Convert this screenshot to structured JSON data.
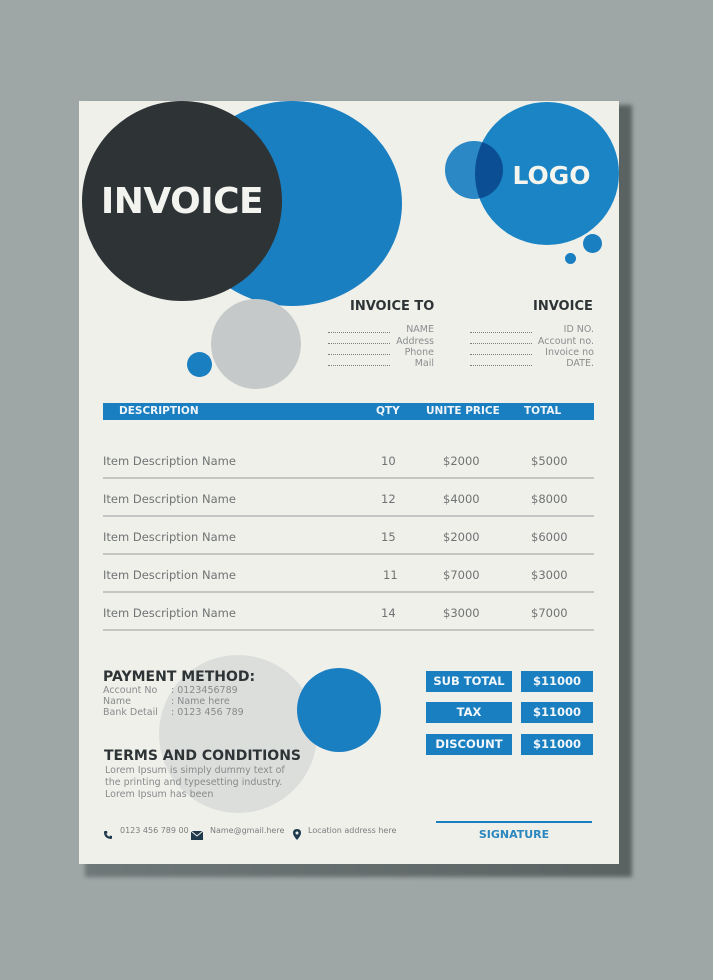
{
  "header": {
    "title": "INVOICE",
    "logo_text": "LOGO"
  },
  "invoice_to": {
    "heading": "INVOICE TO",
    "fields": [
      "NAME",
      "Address",
      "Phone",
      "Mail"
    ]
  },
  "invoice_info": {
    "heading": "INVOICE",
    "fields": [
      "ID NO.",
      "Account no.",
      "Invoice no",
      "DATE."
    ]
  },
  "table": {
    "columns": [
      "DESCRIPTION",
      "QTY",
      "UNITE PRICE",
      "TOTAL"
    ],
    "rows": [
      {
        "description": "Item Description Name",
        "qty": "10",
        "price": "$2000",
        "total": "$5000"
      },
      {
        "description": "Item Description Name",
        "qty": "12",
        "price": "$4000",
        "total": "$8000"
      },
      {
        "description": "Item Description Name",
        "qty": "15",
        "price": "$2000",
        "total": "$6000"
      },
      {
        "description": "Item Description Name",
        "qty": "11",
        "price": "$7000",
        "total": "$3000"
      },
      {
        "description": "Item Description Name",
        "qty": "14",
        "price": "$3000",
        "total": "$7000"
      }
    ]
  },
  "payment": {
    "heading": "PAYMENT METHOD:",
    "rows": [
      {
        "label": "Account No",
        "value": ": 0123456789"
      },
      {
        "label": "Name",
        "value": ": Name here"
      },
      {
        "label": "Bank Detail",
        "value": ": 0123 456 789"
      }
    ]
  },
  "terms": {
    "heading": "TERMS AND CONDITIONS",
    "text": "Lorem Ipsum is simply dummy text of the printing and typesetting industry. Lorem Ipsum has been"
  },
  "summary": [
    {
      "label": "SUB TOTAL",
      "value": "$11000"
    },
    {
      "label": "TAX",
      "value": "$11000"
    },
    {
      "label": "DISCOUNT",
      "value": "$11000"
    }
  ],
  "footer": {
    "phone": "0123 456 789 00",
    "email": "Name@gmail.here",
    "location": "Location address here",
    "signature": "SIGNATURE",
    "icons": [
      "phone-icon",
      "mail-icon",
      "location-pin-icon"
    ]
  },
  "colors": {
    "accent": "#1a7fc1",
    "dark": "#2e3436",
    "background": "#9ea6a6",
    "paper": "#f0f0eb"
  }
}
